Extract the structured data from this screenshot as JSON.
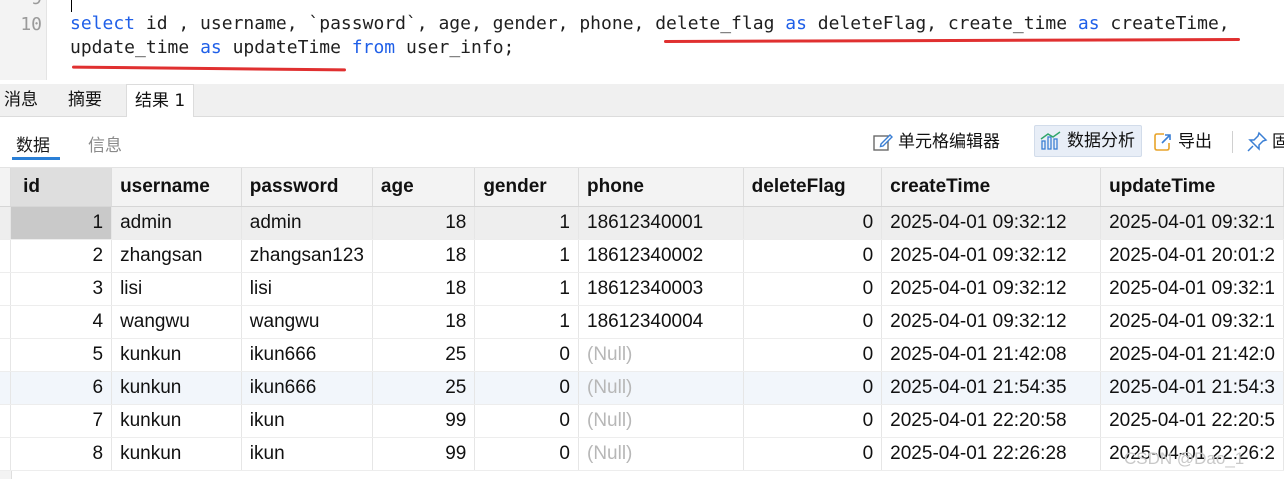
{
  "editor": {
    "line_numbers": [
      "9",
      "10"
    ],
    "line1": {
      "kw_select": "select",
      "cols_a": " id , username, `password`, age, gender, phone, ",
      "delete_flag": "delete_flag",
      "kw_as1": "as",
      "alias1": " deleteFlag, ",
      "create_time": "create_time",
      "kw_as2": "as",
      "alias2": " createTime,"
    },
    "line2": {
      "update_time": "update_time",
      "kw_as3": "as",
      "alias3": " updateTime ",
      "kw_from": "from",
      "table": " user_info;"
    },
    "underline_color": "#e03030"
  },
  "panel_tabs": [
    "消息",
    "摘要",
    "结果 1"
  ],
  "sub_tabs": {
    "data": "数据",
    "info": "信息"
  },
  "toolbar": {
    "cell_editor": "单元格编辑器",
    "data_analysis": "数据分析",
    "export": "导出",
    "pin_partial": "固"
  },
  "grid": {
    "columns": [
      "id",
      "username",
      "password",
      "age",
      "gender",
      "phone",
      "deleteFlag",
      "createTime",
      "updateTime"
    ],
    "rows": [
      [
        "1",
        "admin",
        "admin",
        "18",
        "1",
        "18612340001",
        "0",
        "2025-04-01 09:32:12",
        "2025-04-01 09:32:1"
      ],
      [
        "2",
        "zhangsan",
        "zhangsan123",
        "18",
        "1",
        "18612340002",
        "0",
        "2025-04-01 09:32:12",
        "2025-04-01 20:01:2"
      ],
      [
        "3",
        "lisi",
        "lisi",
        "18",
        "1",
        "18612340003",
        "0",
        "2025-04-01 09:32:12",
        "2025-04-01 09:32:1"
      ],
      [
        "4",
        "wangwu",
        "wangwu",
        "18",
        "1",
        "18612340004",
        "0",
        "2025-04-01 09:32:12",
        "2025-04-01 09:32:1"
      ],
      [
        "5",
        "kunkun",
        "ikun666",
        "25",
        "0",
        "(Null)",
        "0",
        "2025-04-01 21:42:08",
        "2025-04-01 21:42:0"
      ],
      [
        "6",
        "kunkun",
        "ikun666",
        "25",
        "0",
        "(Null)",
        "0",
        "2025-04-01 21:54:35",
        "2025-04-01 21:54:3"
      ],
      [
        "7",
        "kunkun",
        "ikun",
        "99",
        "0",
        "(Null)",
        "0",
        "2025-04-01 22:20:58",
        "2025-04-01 22:20:5"
      ],
      [
        "8",
        "kunkun",
        "ikun",
        "99",
        "0",
        "(Null)",
        "0",
        "2025-04-01 22:26:28",
        "2025-04-01 22:26:2"
      ]
    ],
    "selected_row": 1,
    "highlight_row": 6
  },
  "watermark": "CSDN @Dao_1"
}
